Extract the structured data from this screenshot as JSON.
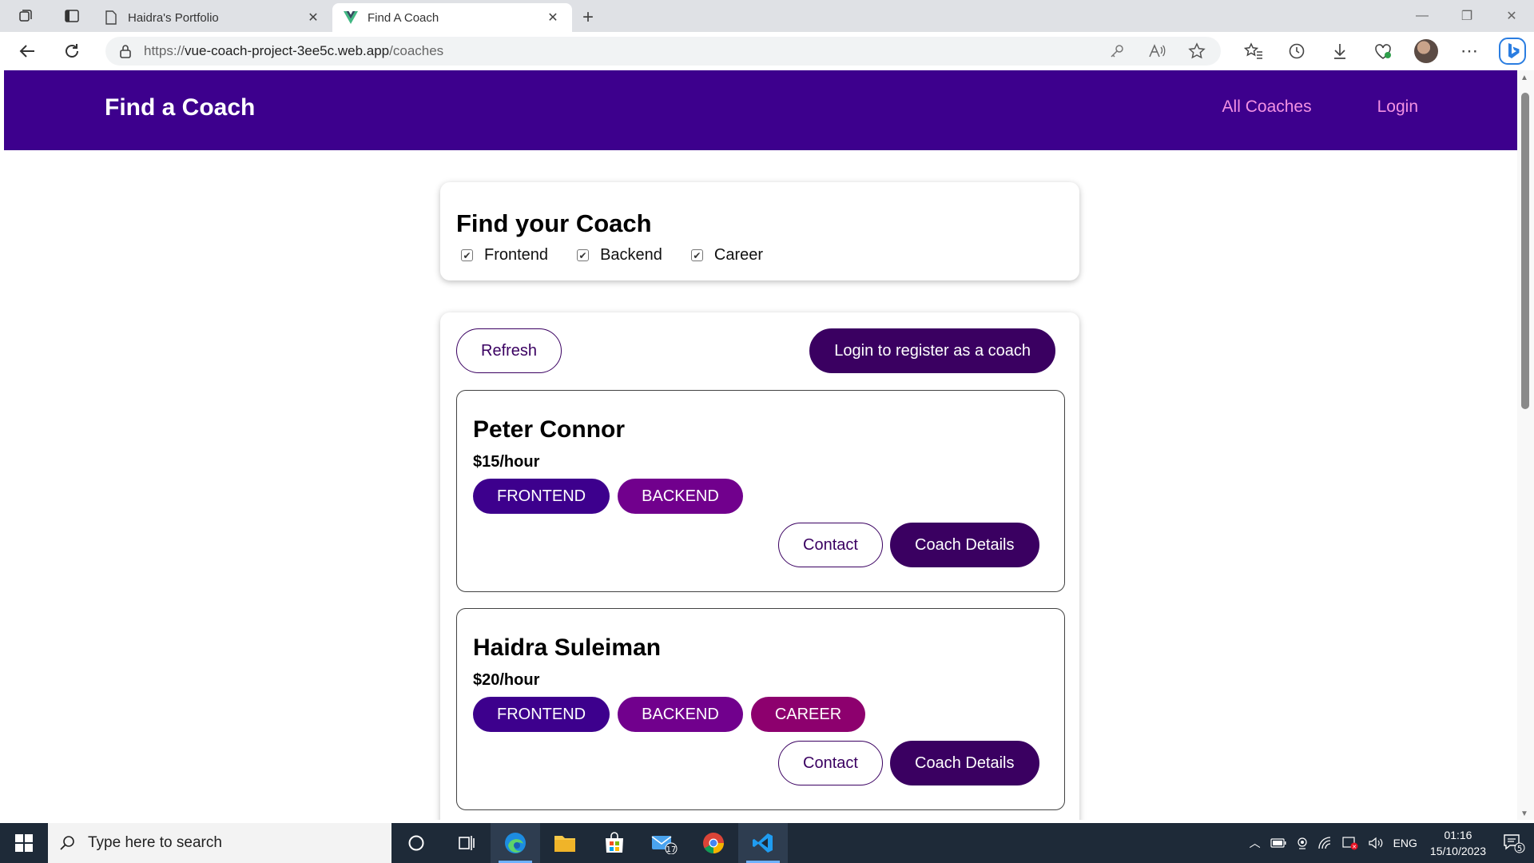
{
  "browser": {
    "tabs": [
      {
        "title": "Haidra's Portfolio",
        "active": false
      },
      {
        "title": "Find A Coach",
        "active": true
      }
    ],
    "url_prefix": "https://",
    "url_host": "vue-coach-project-3ee5c.web.app",
    "url_path": "/coaches"
  },
  "site": {
    "title": "Find a Coach",
    "nav": [
      "All Coaches",
      "Login"
    ]
  },
  "filter": {
    "heading": "Find your Coach",
    "options": [
      {
        "label": "Frontend",
        "checked": true
      },
      {
        "label": "Backend",
        "checked": true
      },
      {
        "label": "Career",
        "checked": true
      }
    ]
  },
  "controls": {
    "refresh_label": "Refresh",
    "register_label": "Login to register as a coach"
  },
  "coaches": [
    {
      "name": "Peter Connor",
      "rate": "$15/hour",
      "areas": [
        "FRONTEND",
        "BACKEND"
      ],
      "contact_label": "Contact",
      "details_label": "Coach Details"
    },
    {
      "name": "Haidra Suleiman",
      "rate": "$20/hour",
      "areas": [
        "FRONTEND",
        "BACKEND",
        "CAREER"
      ],
      "contact_label": "Contact",
      "details_label": "Coach Details"
    }
  ],
  "colors": {
    "header_bg": "#3d008d",
    "nav_link": "#f391e3",
    "primary_button": "#3a0061",
    "badge_frontend": "#3d008d",
    "badge_backend": "#71008d",
    "badge_career": "#8d006e"
  },
  "taskbar": {
    "search_placeholder": "Type here to search",
    "mail_badge": "17",
    "language": "ENG",
    "time": "01:16",
    "date": "15/10/2023",
    "notifications": "5"
  }
}
